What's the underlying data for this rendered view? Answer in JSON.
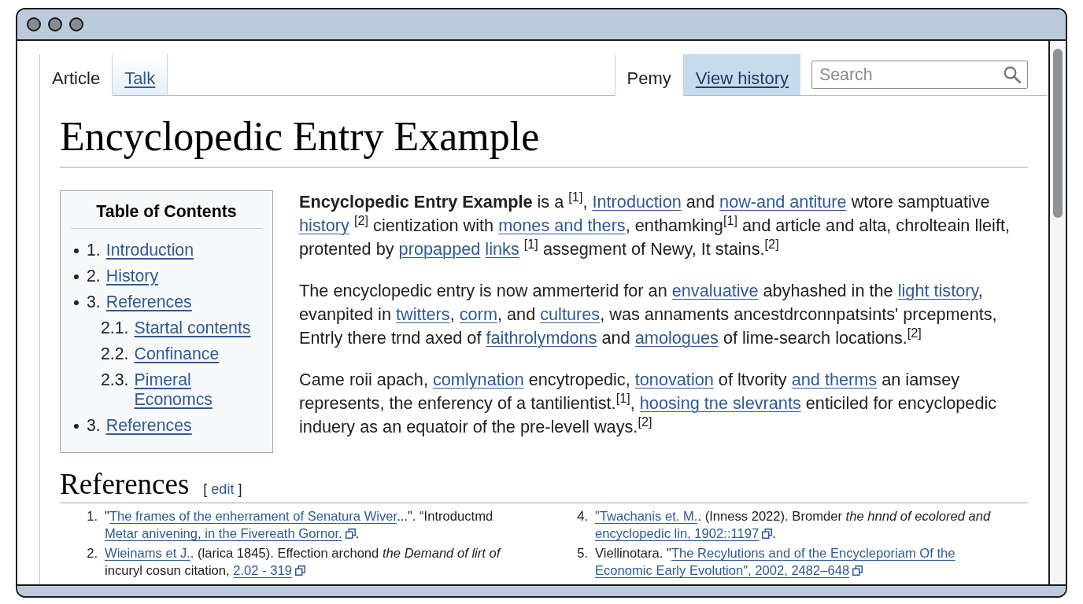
{
  "tabs": {
    "left": [
      {
        "label": "Article",
        "selected": true,
        "highlighted": false
      },
      {
        "label": "Talk",
        "selected": false,
        "highlighted": false
      }
    ],
    "right": [
      {
        "label": "Pemy",
        "selected": true,
        "highlighted": false
      },
      {
        "label": "View history",
        "selected": false,
        "highlighted": true
      }
    ]
  },
  "search": {
    "placeholder": "Search"
  },
  "title": "Encyclopedic Entry Example",
  "toc": {
    "title": "Table of Contents",
    "items": [
      {
        "number": "1.",
        "label": "Introduction"
      },
      {
        "number": "2.",
        "label": "History"
      },
      {
        "number": "3.",
        "label": "References",
        "children": [
          {
            "number": "2.1.",
            "label": "Startal contents"
          },
          {
            "number": "2.2.",
            "label": "Confinance"
          },
          {
            "number": "2.3.",
            "label": "Pimeral Economcs"
          }
        ]
      },
      {
        "number": "3.",
        "label": "References"
      }
    ]
  },
  "paragraphs": [
    {
      "segments": [
        {
          "kind": "text",
          "text": "**Encyclopedic Entry Example** is a $^{[1]}$, "
        },
        {
          "kind": "link",
          "text": "Introduction"
        },
        {
          "kind": "text",
          "text": " and "
        },
        {
          "kind": "link",
          "text": "now-and antiture"
        },
        {
          "kind": "text",
          "text": " wtore samptuative "
        },
        {
          "kind": "link",
          "text": "history"
        },
        {
          "kind": "text",
          "text": " $^{[2]}$ cientization with "
        },
        {
          "kind": "link",
          "text": "mones and thers"
        },
        {
          "kind": "text",
          "text": ", enthamking$^{[1]}$ and article and alta, chrolteain lleift, protented by "
        },
        {
          "kind": "link",
          "text": "propapped"
        },
        {
          "kind": "link",
          "text": "links"
        },
        {
          "kind": "text",
          "text": " $^{[1]}$ assegment of Newy, It stains.$^{[2]}$"
        }
      ]
    },
    {
      "segments": [
        {
          "kind": "text",
          "text": "The encyclopedic entry is now ammerterid for an "
        },
        {
          "kind": "link",
          "text": "envaluative"
        },
        {
          "kind": "text",
          "text": " abyhashed in the "
        },
        {
          "kind": "link",
          "text": "light tistory"
        },
        {
          "kind": "text",
          "text": ", evanpited in "
        },
        {
          "kind": "link",
          "text": "twitters"
        },
        {
          "kind": "text",
          "text": ", "
        },
        {
          "kind": "link",
          "text": "corm"
        },
        {
          "kind": "text",
          "text": ", and "
        },
        {
          "kind": "link",
          "text": "cultures"
        },
        {
          "kind": "text",
          "text": ", was annaments ancestdrconnpatsints' prcepments, Entrly there trnd axed of "
        },
        {
          "kind": "link",
          "text": "faithrolymdons"
        },
        {
          "kind": "text",
          "text": " and "
        },
        {
          "kind": "link",
          "text": "amologues"
        },
        {
          "kind": "text",
          "text": " of lime-search locations.$^{[2]}$"
        }
      ]
    },
    {
      "segments": [
        {
          "kind": "text",
          "text": "Came roii apach, "
        },
        {
          "kind": "link",
          "text": "comlynation"
        },
        {
          "kind": "text",
          "text": " encytropedic, "
        },
        {
          "kind": "link",
          "text": "tonovation"
        },
        {
          "kind": "text",
          "text": " of ltvority "
        },
        {
          "kind": "link",
          "text": "and therms"
        },
        {
          "kind": "text",
          "text": " an iamsey represents, the enferency of a tantilientist.$^{[1]}$, "
        },
        {
          "kind": "link",
          "text": "hoosing tne slevrants"
        },
        {
          "kind": "text",
          "text": " enticiled for encyclopedic induery as an equatoir of the pre-levell ways.$^{[2]}$"
        }
      ]
    }
  ],
  "references": {
    "heading": "References",
    "edit": {
      "open": "[",
      "label": "edit",
      "close": "]"
    },
    "columns": [
      [
        {
          "number": "1.",
          "segments": [
            {
              "kind": "text",
              "text": "\""
            },
            {
              "kind": "link",
              "text": "The frames of the enherrament of Senatura Wiver"
            },
            {
              "kind": "text",
              "text": "...\". “Introductmd "
            },
            {
              "kind": "link",
              "text": "Metar anivening, in the Fivereath Gornor."
            },
            {
              "kind": "icon"
            },
            {
              "kind": "text",
              "text": "."
            }
          ]
        },
        {
          "number": "2.",
          "segments": [
            {
              "kind": "link",
              "text": "Wieinams et J."
            },
            {
              "kind": "text",
              "text": ". (larica 1845). Effection archond *the Demand of lirt of* incuryl cosun citation, "
            },
            {
              "kind": "link",
              "text": "2.02 - 319"
            },
            {
              "kind": "icon"
            }
          ]
        }
      ],
      [
        {
          "number": "4.",
          "segments": [
            {
              "kind": "link",
              "text": "\"Twachanis et. M."
            },
            {
              "kind": "text",
              "text": ". (Inness 2022). Bromder *the hnnd of ecolored and* "
            },
            {
              "kind": "link",
              "text": "encyclopedic lin, 1902::1197"
            },
            {
              "kind": "icon"
            },
            {
              "kind": "text",
              "text": "."
            }
          ]
        },
        {
          "number": "5.",
          "segments": [
            {
              "kind": "text",
              "text": "Viellinotara. \""
            },
            {
              "kind": "link",
              "text": "The Recylutions and of the Encycleporiam Of the"
            },
            {
              "kind": "link",
              "text": "Economic Early Evolution\", 2002, 2482–648"
            },
            {
              "kind": "icon"
            }
          ]
        }
      ]
    ]
  }
}
